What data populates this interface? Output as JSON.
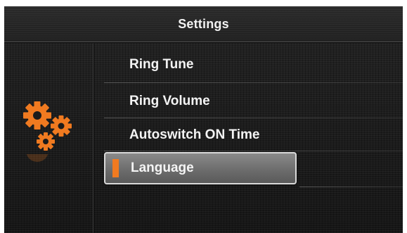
{
  "header": {
    "title": "Settings"
  },
  "menu": {
    "items": [
      {
        "label": "Ring Tune",
        "selected": false
      },
      {
        "label": "Ring Volume",
        "selected": false
      },
      {
        "label": "Autoswitch ON Time",
        "selected": false
      },
      {
        "label": "Language",
        "selected": true
      }
    ]
  },
  "icons": {
    "category": "gears-icon"
  },
  "colors": {
    "accent": "#f07a20",
    "background": "#1b1b1b",
    "text": "#f4f4f4",
    "selection_border": "#d9d9d9"
  }
}
